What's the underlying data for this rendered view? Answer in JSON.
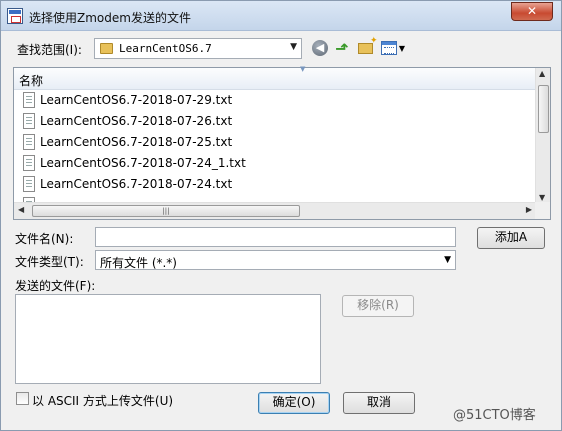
{
  "window": {
    "title": "选择使用Zmodem发送的文件",
    "close_label": "✕"
  },
  "lookin": {
    "label": "查找范围(I):",
    "value": "LearnCentOS6.7"
  },
  "toolbar": {
    "back_icon": "back-arrow-icon",
    "up_icon": "up-folder-icon",
    "new_folder_icon": "new-folder-icon",
    "view_icon": "view-menu-icon"
  },
  "filelist": {
    "column_name": "名称",
    "files": [
      "LearnCentOS6.7-2018-07-29.txt",
      "LearnCentOS6.7-2018-07-26.txt",
      "LearnCentOS6.7-2018-07-25.txt",
      "LearnCentOS6.7-2018-07-24_1.txt",
      "LearnCentOS6.7-2018-07-24.txt"
    ]
  },
  "form": {
    "filename_label": "文件名(N):",
    "filename_value": "",
    "filetype_label": "文件类型(T):",
    "filetype_value": "所有文件 (*.*)",
    "sent_files_label": "发送的文件(F):",
    "add_button": "添加A",
    "remove_button": "移除(R)",
    "ascii_checkbox_label": "以 ASCII 方式上传文件(U)",
    "ascii_checked": false,
    "ok_button": "确定(O)",
    "cancel_button": "取消"
  },
  "watermark": "@51CTO博客"
}
